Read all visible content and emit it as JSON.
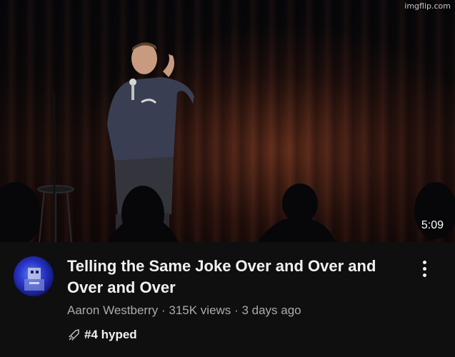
{
  "thumbnail": {
    "watermark": "imgflip.com",
    "duration": "5:09"
  },
  "video": {
    "title": "Telling the Same Joke Over and Over and Over and Over",
    "channel": "Aaron Westberry",
    "views": "315K views",
    "age": "3 days ago",
    "separator": "·",
    "hype_label": "#4 hyped"
  },
  "icons": {
    "hype": "hype-rocket-icon",
    "more": "more-vertical-icon"
  }
}
